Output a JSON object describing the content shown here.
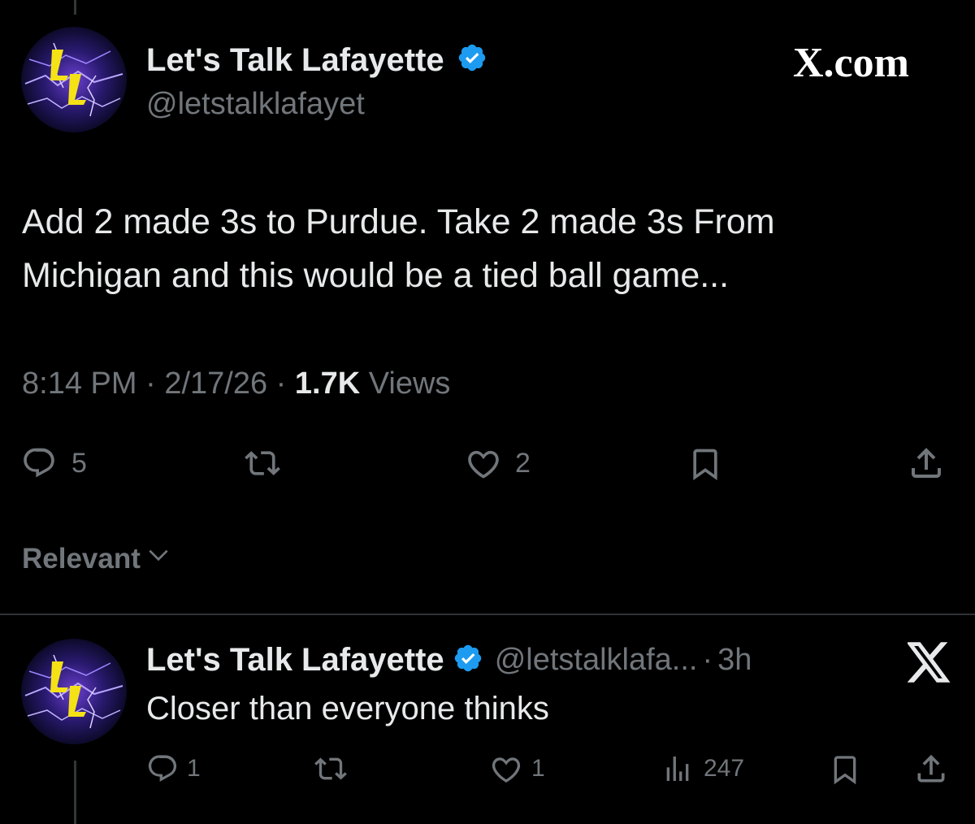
{
  "main_post": {
    "display_name": "Let's Talk Lafayette",
    "handle": "@letstalklafayet",
    "brand": "X.com",
    "text_line1": "Add 2 made 3s to Purdue. Take 2 made 3s From",
    "text_line2": "Michigan and this would be a tied ball game...",
    "time": "8:14 PM",
    "date": "2/17/26",
    "views_count": "1.7K",
    "views_label": "Views",
    "separator": "·",
    "replies": "5",
    "likes": "2"
  },
  "sort": {
    "label": "Relevant"
  },
  "reply": {
    "display_name": "Let's Talk Lafayette",
    "handle": "@letstalklafa...",
    "separator": "·",
    "age": "3h",
    "text": "Closer than everyone thinks",
    "replies": "1",
    "likes": "1",
    "views": "247"
  },
  "colors": {
    "background": "#000000",
    "text": "#e7e9ea",
    "muted": "#71767b",
    "verified": "#1d9bf0",
    "avatar_logo": "#f5e216"
  },
  "icons": [
    "verified-badge-icon",
    "reply-icon",
    "retweet-icon",
    "like-icon",
    "bookmark-icon",
    "share-icon",
    "chevron-down-icon",
    "views-icon",
    "x-logo-icon"
  ]
}
